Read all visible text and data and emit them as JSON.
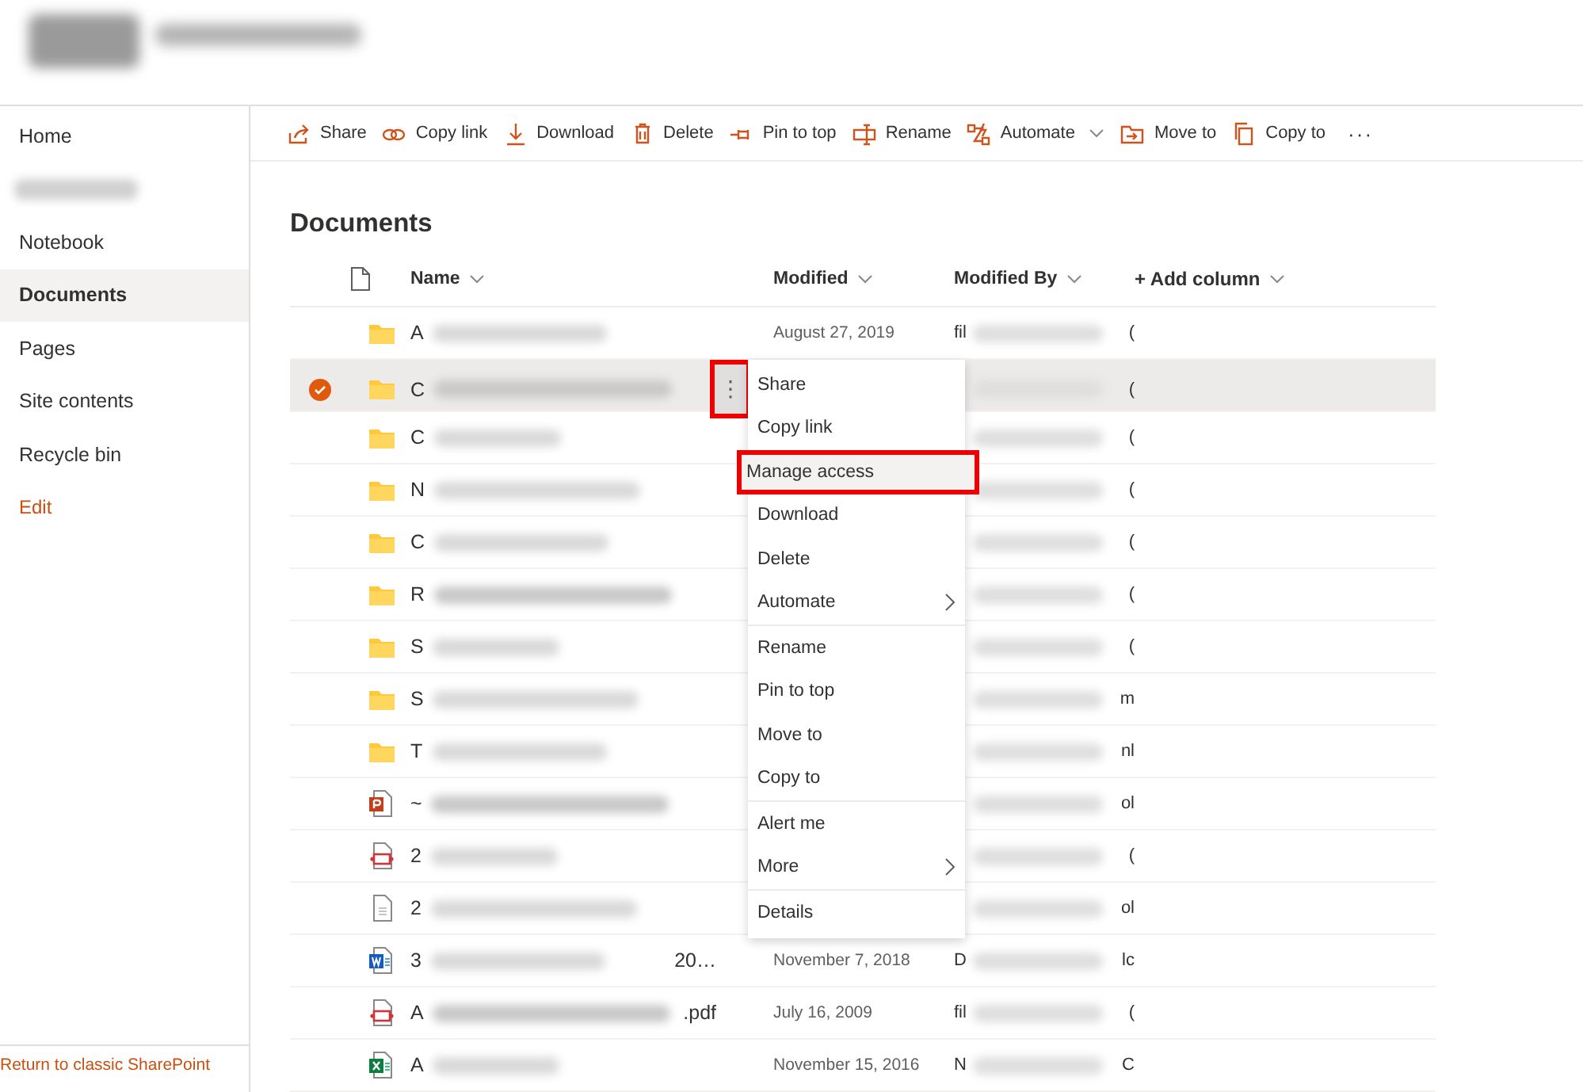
{
  "header": {
    "logo": {
      "kind": "redacted"
    },
    "site_title": {
      "kind": "redacted"
    }
  },
  "sidebar": {
    "items": [
      {
        "kind": "link",
        "label": "Home",
        "selected": false
      },
      {
        "kind": "redacted",
        "selected": false
      },
      {
        "kind": "link",
        "label": "Notebook",
        "selected": false
      },
      {
        "kind": "link",
        "label": "Documents",
        "selected": true
      },
      {
        "kind": "link",
        "label": "Pages",
        "selected": false
      },
      {
        "kind": "link",
        "label": "Site contents",
        "selected": false
      },
      {
        "kind": "link",
        "label": "Recycle bin",
        "selected": false
      },
      {
        "kind": "edit",
        "label": "Edit",
        "selected": false
      }
    ],
    "footer_link": "Return to classic SharePoint"
  },
  "toolbar": {
    "items": [
      {
        "label": "Share",
        "dropdown": false
      },
      {
        "label": "Copy link",
        "dropdown": false
      },
      {
        "label": "Download",
        "dropdown": false
      },
      {
        "label": "Delete",
        "dropdown": false
      },
      {
        "label": "Pin to top",
        "dropdown": false
      },
      {
        "label": "Rename",
        "dropdown": false
      },
      {
        "label": "Automate",
        "dropdown": true
      },
      {
        "label": "Move to",
        "dropdown": false
      },
      {
        "label": "Copy to",
        "dropdown": false
      }
    ],
    "overflow": "···"
  },
  "library": {
    "title": "Documents",
    "columns": [
      {
        "label": "Name",
        "sortable": true
      },
      {
        "label": "Modified",
        "sortable": true
      },
      {
        "label": "Modified By",
        "sortable": true
      },
      {
        "label": "+ Add column",
        "sortable": true
      }
    ],
    "rows": [
      {
        "kind": "folder",
        "name_start": "A",
        "modified": "August 27, 2019",
        "modified_by": "fil",
        "column_5": "(",
        "selected": false
      },
      {
        "kind": "folder",
        "name_start": "C",
        "column_5": "(",
        "selected": true
      },
      {
        "kind": "folder",
        "name_start": "C",
        "column_5": "(",
        "selected": false
      },
      {
        "kind": "folder",
        "name_start": "N",
        "column_5": "(",
        "selected": false
      },
      {
        "kind": "folder",
        "name_start": "C",
        "column_5": "(",
        "selected": false
      },
      {
        "kind": "folder",
        "name_start": "R",
        "column_5": "(",
        "selected": false
      },
      {
        "kind": "folder",
        "name_start": "S",
        "column_5": "(",
        "selected": false
      },
      {
        "kind": "folder",
        "name_start": "S",
        "column_5": "m",
        "selected": false
      },
      {
        "kind": "folder",
        "name_start": "T",
        "column_5": "nl",
        "selected": false
      },
      {
        "kind": "powerpoint",
        "name_start": "~",
        "column_5": "ol",
        "selected": false
      },
      {
        "kind": "pdf",
        "name_start": "2",
        "column_5": "(",
        "selected": false
      },
      {
        "kind": "file",
        "name_start": "2",
        "column_5": "ol",
        "selected": false
      },
      {
        "kind": "word",
        "name_start": "3",
        "name_end": "20…",
        "modified": "November 7, 2018",
        "modified_by": "D",
        "column_5": "lc",
        "selected": false
      },
      {
        "kind": "pdf",
        "name_start": "A",
        "name_end": ".pdf",
        "modified": "July 16, 2009",
        "modified_by": "fil",
        "column_5": "(",
        "selected": false
      },
      {
        "kind": "excel",
        "name_start": "A",
        "modified": "November 15, 2016",
        "modified_by": "N",
        "column_5": "C",
        "selected": false
      }
    ]
  },
  "more_button": {
    "label": "⋮",
    "annotated": true
  },
  "context_menu": {
    "groups": [
      [
        {
          "label": "Share",
          "submenu": false,
          "hovered": false,
          "annotated": false
        },
        {
          "label": "Copy link",
          "submenu": false,
          "hovered": false,
          "annotated": false
        },
        {
          "label": "Manage access",
          "submenu": false,
          "hovered": true,
          "annotated": true
        },
        {
          "label": "Download",
          "submenu": false,
          "hovered": false,
          "annotated": false
        },
        {
          "label": "Delete",
          "submenu": false,
          "hovered": false,
          "annotated": false
        },
        {
          "label": "Automate",
          "submenu": true,
          "hovered": false,
          "annotated": false
        }
      ],
      [
        {
          "label": "Rename",
          "submenu": false,
          "hovered": false,
          "annotated": false
        },
        {
          "label": "Pin to top",
          "submenu": false,
          "hovered": false,
          "annotated": false
        },
        {
          "label": "Move to",
          "submenu": false,
          "hovered": false,
          "annotated": false
        },
        {
          "label": "Copy to",
          "submenu": false,
          "hovered": false,
          "annotated": false
        }
      ],
      [
        {
          "label": "Alert me",
          "submenu": false,
          "hovered": false,
          "annotated": false
        },
        {
          "label": "More",
          "submenu": true,
          "hovered": false,
          "annotated": false
        }
      ],
      [
        {
          "label": "Details",
          "submenu": false,
          "hovered": false,
          "annotated": false
        }
      ]
    ]
  }
}
